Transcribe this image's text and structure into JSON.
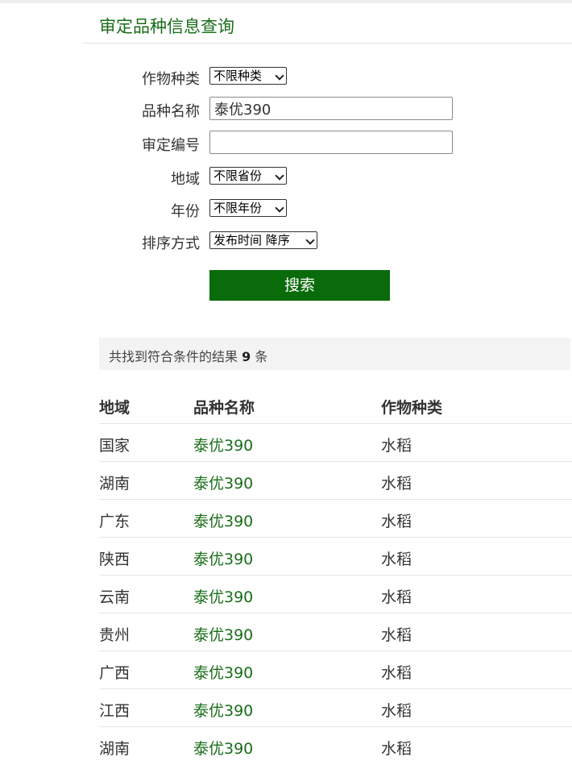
{
  "page": {
    "title": "审定品种信息查询"
  },
  "form": {
    "crop_type": {
      "label": "作物种类",
      "value": "不限种类"
    },
    "variety_name": {
      "label": "品种名称",
      "value": "泰优390"
    },
    "approval_no": {
      "label": "审定编号",
      "value": ""
    },
    "region": {
      "label": "地域",
      "value": "不限省份"
    },
    "year": {
      "label": "年份",
      "value": "不限年份"
    },
    "sort": {
      "label": "排序方式",
      "value": "发布时间 降序"
    },
    "search_label": "搜索"
  },
  "result_summary": {
    "prefix": "共找到符合条件的结果",
    "count": "9",
    "suffix": "条"
  },
  "table": {
    "columns": [
      "地域",
      "品种名称",
      "作物种类"
    ],
    "rows": [
      [
        "国家",
        "泰优390",
        "水稻"
      ],
      [
        "湖南",
        "泰优390",
        "水稻"
      ],
      [
        "广东",
        "泰优390",
        "水稻"
      ],
      [
        "陕西",
        "泰优390",
        "水稻"
      ],
      [
        "云南",
        "泰优390",
        "水稻"
      ],
      [
        "贵州",
        "泰优390",
        "水稻"
      ],
      [
        "广西",
        "泰优390",
        "水稻"
      ],
      [
        "江西",
        "泰优390",
        "水稻"
      ],
      [
        "湖南",
        "泰优390",
        "水稻"
      ]
    ]
  },
  "colors": {
    "accent": "#0a6b0a",
    "link": "#1a6e1a"
  }
}
